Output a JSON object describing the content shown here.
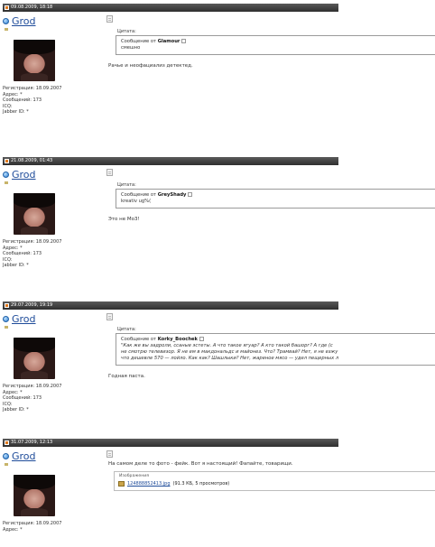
{
  "posts": [
    {
      "date": "09.08.2009, 18:18",
      "username": "Grod",
      "info": [
        "Регистрация: 18.09.2007",
        "Адрес: *",
        "Сообщений: 173",
        "ICQ:",
        "Jabber ID: *"
      ],
      "quote": {
        "label": "Цитата:",
        "from_prefix": "Сообщение от",
        "author": "Glamour",
        "lines": [
          "смешно"
        ]
      },
      "message": "Рачье и неофациализ детектед."
    },
    {
      "date": "21.08.2009, 01:43",
      "username": "Grod",
      "info": [
        "Регистрация: 18.09.2007",
        "Адрес: *",
        "Сообщений: 173",
        "ICQ:",
        "Jabber ID: *"
      ],
      "quote": {
        "label": "Цитата:",
        "from_prefix": "Сообщение от",
        "author": "GreyShady",
        "lines": [
          "kreativ ug%("
        ]
      },
      "message": "Это не Mo3!"
    },
    {
      "date": "29.07.2009, 19:19",
      "username": "Grod",
      "info": [
        "Регистрация: 18.09.2007",
        "Адрес: *",
        "Сообщений: 173",
        "ICQ:",
        "Jabber ID: *"
      ],
      "quote": {
        "label": "Цитата:",
        "from_prefix": "Сообщение от",
        "author": "Korky_Boochek",
        "lines": [
          "\"Как же вы задроли, ссаные эстеты. А что такое ягуар? А кто такой башорг? А где (с",
          "не смотрю телевизор. Я не ем в макдональдс и майонез. Что? Трамвай? Нет, я не езжу",
          "что дешевле 570 — лойло. Как как? Шашлыки? Нет, жареное мясо — удел пещерных л"
        ]
      },
      "message": "Годная паста."
    },
    {
      "date": "31.07.2009, 12:13",
      "username": "Grod",
      "info": [
        "Регистрация: 18.09.2007",
        "Адрес: *"
      ],
      "message": "На самом деле то фото - фейк. Вот я настоящий! Фапайте, товарищи.",
      "attachment": {
        "title": "Изображения",
        "filename": "124888852413.jpg",
        "meta": "(91.3 КБ, 5 просмотров)"
      }
    }
  ]
}
